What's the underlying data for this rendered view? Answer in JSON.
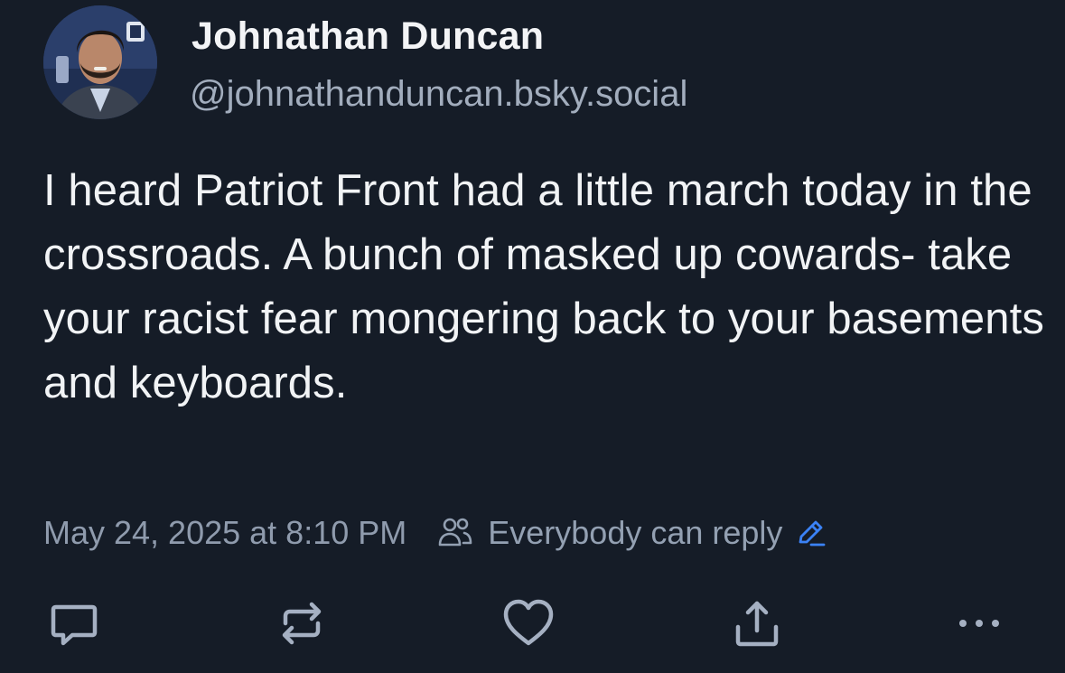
{
  "author": {
    "display_name": "Johnathan Duncan",
    "handle": "@johnathanduncan.bsky.social",
    "avatar_icon": "profile-photo"
  },
  "post": {
    "text": "I heard Patriot Front had a little march today in the crossroads. A bunch of masked up cowards- take your racist fear mongering back to your basements and keyboards.",
    "timestamp": "May 24, 2025 at 8:10 PM",
    "reply_setting": "Everybody can reply"
  },
  "actions": [
    {
      "name": "reply",
      "icon": "comment-icon"
    },
    {
      "name": "repost",
      "icon": "repost-icon"
    },
    {
      "name": "like",
      "icon": "heart-icon"
    },
    {
      "name": "share",
      "icon": "share-icon"
    },
    {
      "name": "more",
      "icon": "ellipsis-icon"
    }
  ],
  "colors": {
    "background": "#151c27",
    "text": "#f1f3f5",
    "muted": "#8f9bad",
    "accent": "#3b82f6",
    "icon": "#a5b0c2"
  }
}
